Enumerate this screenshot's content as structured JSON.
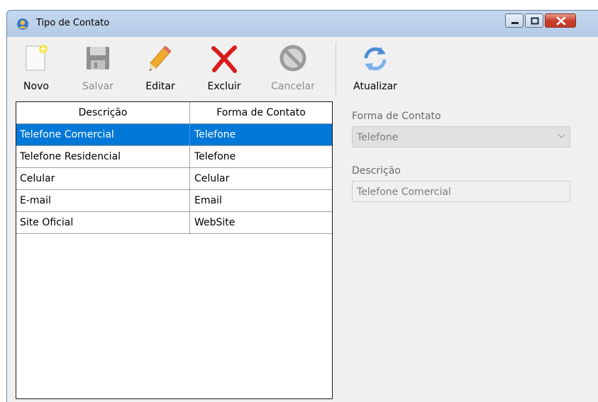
{
  "window": {
    "title": "Tipo de Contato",
    "controls": {
      "minimize": "minimize",
      "maximize": "maximize",
      "close": "close"
    }
  },
  "toolbar": {
    "novo": {
      "label": "Novo",
      "icon": "new-document-icon",
      "enabled": true
    },
    "salvar": {
      "label": "Salvar",
      "icon": "floppy-disk-icon",
      "enabled": false
    },
    "editar": {
      "label": "Editar",
      "icon": "pencil-icon",
      "enabled": true
    },
    "excluir": {
      "label": "Excluir",
      "icon": "red-x-icon",
      "enabled": true
    },
    "cancelar": {
      "label": "Cancelar",
      "icon": "cancel-circle-icon",
      "enabled": false
    },
    "atualizar": {
      "label": "Atualizar",
      "icon": "refresh-icon",
      "enabled": true
    }
  },
  "grid": {
    "columns": [
      "Descrição",
      "Forma de Contato"
    ],
    "rows": [
      [
        "Telefone Comercial",
        "Telefone"
      ],
      [
        "Telefone Residencial",
        "Telefone"
      ],
      [
        "Celular",
        "Celular"
      ],
      [
        "E-mail",
        "Email"
      ],
      [
        "Site Oficial",
        "WebSite"
      ]
    ],
    "selected_index": 0,
    "selection_color": "#0078d7"
  },
  "form": {
    "forma_label": "Forma de Contato",
    "forma_value": "Telefone",
    "descricao_label": "Descrição",
    "descricao_value": "Telefone Comercial"
  }
}
